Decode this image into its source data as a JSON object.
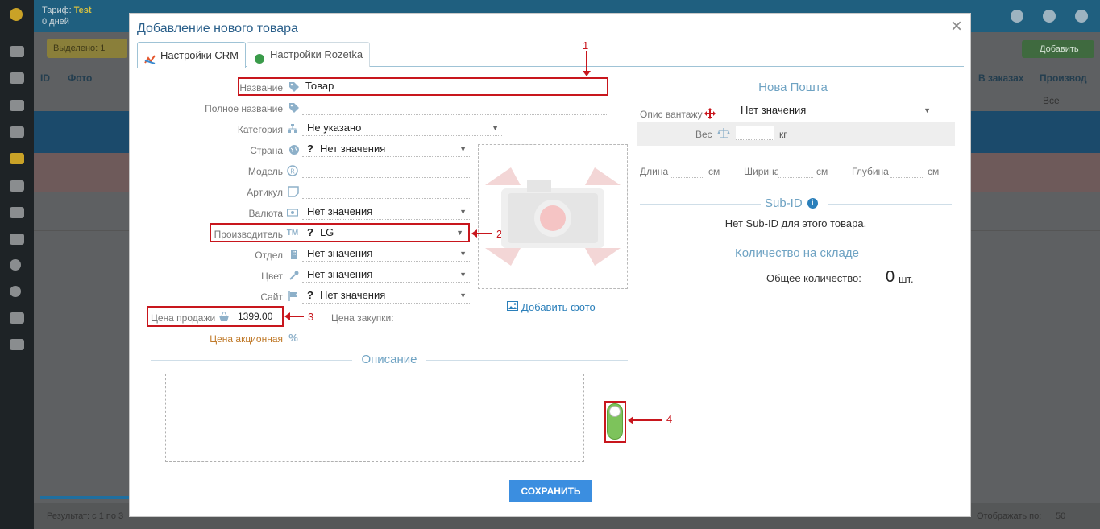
{
  "background": {
    "tariff_label": "Тариф:",
    "tariff_value": "Test",
    "days_label": "0 дней",
    "highlighted_btn": "Выделено: 1",
    "add_btn": "Добавить",
    "col_id": "ID",
    "col_photo": "Фото",
    "col_in_orders": "В заказах",
    "col_manufacturer": "Производ",
    "filter_all": "Все",
    "footer_result": "Результат: с 1 по 3",
    "footer_per_page": "Отображать по:",
    "footer_per_page_value": "50"
  },
  "modal": {
    "title": "Добавление нового товара",
    "close_symbol": "×",
    "tabs": [
      {
        "label": "Настройки CRM",
        "active": true
      },
      {
        "label": "Настройки Rozetka",
        "active": false
      }
    ]
  },
  "form": {
    "name_label": "Название",
    "name_value": "Товар",
    "fullname_label": "Полное название",
    "category_label": "Категория",
    "category_value": "Не указано",
    "country_label": "Страна",
    "country_value": "Нет значения",
    "model_label": "Модель",
    "article_label": "Артикул",
    "currency_label": "Валюта",
    "currency_value": "Нет значения",
    "manufacturer_label": "Производитель",
    "manufacturer_value": "LG",
    "department_label": "Отдел",
    "department_value": "Нет значения",
    "color_label": "Цвет",
    "color_value": "Нет значения",
    "site_label": "Сайт",
    "site_value": "Нет значения",
    "sale_price_label": "Цена продажи",
    "sale_price_value": "1399.00",
    "purchase_price_label": "Цена закупки:",
    "promo_price_label": "Цена акционная",
    "question_mark": "?",
    "add_photo": "Добавить фото",
    "description_title": "Описание",
    "save_button": "СОХРАНИТЬ"
  },
  "nova_poshta": {
    "title": "Нова Пошта",
    "cargo_label": "Опис вантажу",
    "cargo_value": "Нет значения",
    "weight_label": "Вес",
    "weight_unit": "кг",
    "length_label": "Длина",
    "width_label": "Ширина",
    "depth_label": "Глубина",
    "dim_unit": "см"
  },
  "sub_id": {
    "title": "Sub-ID",
    "info_icon": "i",
    "message": "Нет Sub-ID для этого товара."
  },
  "stock": {
    "title": "Количество на складе",
    "total_label": "Общее количество:",
    "total_value": "0",
    "unit": "шт."
  },
  "annotations": [
    "1",
    "2",
    "3",
    "4"
  ],
  "colors": {
    "annotation_red": "#c8161d",
    "accent_blue": "#2a5f8a",
    "save_button": "#3b8ee0",
    "toggle_green": "#7dc35b",
    "section_title": "#6fa3c3"
  }
}
